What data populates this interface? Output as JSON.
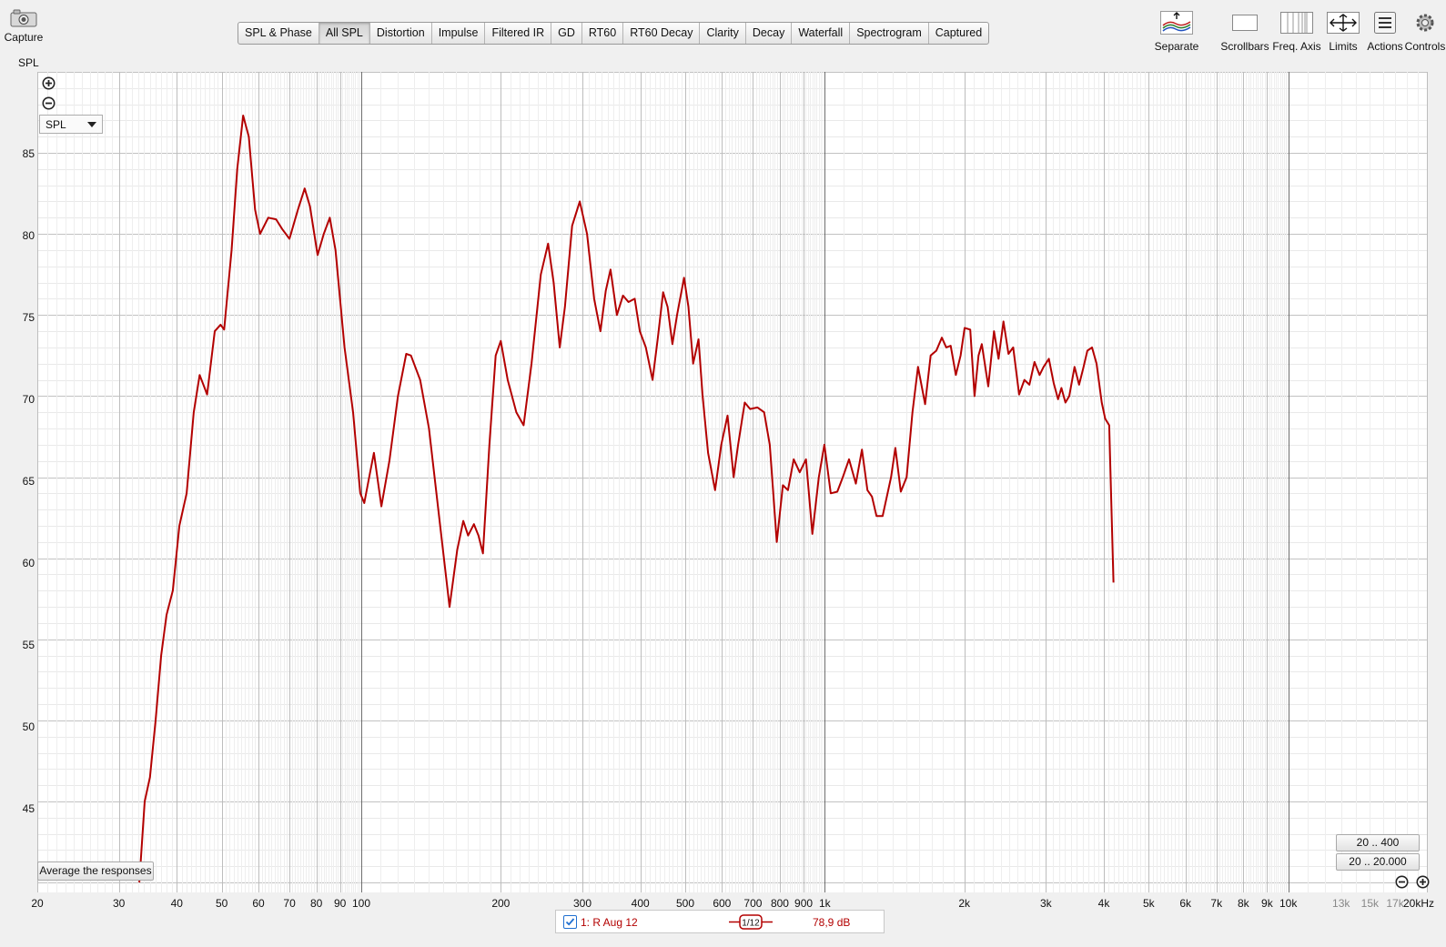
{
  "toolbar": {
    "capture_label": "Capture",
    "spl_label": "SPL",
    "tabs": [
      {
        "label": "SPL & Phase",
        "active": false
      },
      {
        "label": "All SPL",
        "active": true
      },
      {
        "label": "Distortion",
        "active": false
      },
      {
        "label": "Impulse",
        "active": false
      },
      {
        "label": "Filtered IR",
        "active": false
      },
      {
        "label": "GD",
        "active": false
      },
      {
        "label": "RT60",
        "active": false
      },
      {
        "label": "RT60 Decay",
        "active": false
      },
      {
        "label": "Clarity",
        "active": false
      },
      {
        "label": "Decay",
        "active": false
      },
      {
        "label": "Waterfall",
        "active": false
      },
      {
        "label": "Spectrogram",
        "active": false
      },
      {
        "label": "Captured",
        "active": false
      }
    ],
    "tools": {
      "separate": "Separate",
      "scrollbars": "Scrollbars",
      "freq_axis": "Freq. Axis",
      "limits": "Limits",
      "actions": "Actions",
      "controls": "Controls"
    }
  },
  "graph": {
    "selector_value": "SPL",
    "average_button": "Average the responses",
    "range_400": "20 .. 400",
    "range_20000": "20 .. 20.000",
    "line_color": "#b30000"
  },
  "legend": {
    "trace_name": "1: R Aug 12",
    "checked": true,
    "smoothing": "1/12",
    "cursor_value": "78,9 dB"
  },
  "chart_data": {
    "type": "line",
    "x_scale": "log",
    "xlim": [
      20,
      20000
    ],
    "ylim": [
      40,
      90
    ],
    "ylabel": "SPL",
    "grid": true,
    "y_ticks": [
      45,
      50,
      55,
      60,
      65,
      70,
      75,
      80,
      85
    ],
    "x_tick_labels": [
      {
        "f": 20,
        "label": "20"
      },
      {
        "f": 30,
        "label": "30"
      },
      {
        "f": 40,
        "label": "40"
      },
      {
        "f": 50,
        "label": "50"
      },
      {
        "f": 60,
        "label": "60"
      },
      {
        "f": 70,
        "label": "70"
      },
      {
        "f": 80,
        "label": "80"
      },
      {
        "f": 90,
        "label": "90"
      },
      {
        "f": 100,
        "label": "100"
      },
      {
        "f": 200,
        "label": "200"
      },
      {
        "f": 300,
        "label": "300"
      },
      {
        "f": 400,
        "label": "400"
      },
      {
        "f": 500,
        "label": "500"
      },
      {
        "f": 600,
        "label": "600"
      },
      {
        "f": 700,
        "label": "700"
      },
      {
        "f": 800,
        "label": "800"
      },
      {
        "f": 900,
        "label": "900"
      },
      {
        "f": 1000,
        "label": "1k"
      },
      {
        "f": 2000,
        "label": "2k"
      },
      {
        "f": 3000,
        "label": "3k"
      },
      {
        "f": 4000,
        "label": "4k"
      },
      {
        "f": 5000,
        "label": "5k"
      },
      {
        "f": 6000,
        "label": "6k"
      },
      {
        "f": 7000,
        "label": "7k"
      },
      {
        "f": 8000,
        "label": "8k"
      },
      {
        "f": 9000,
        "label": "9k"
      },
      {
        "f": 10000,
        "label": "10k"
      },
      {
        "f": 13000,
        "label": "13k",
        "minor": true
      },
      {
        "f": 15000,
        "label": "15k",
        "minor": true
      },
      {
        "f": 17000,
        "label": "17k",
        "minor": true
      },
      {
        "f": 20000,
        "label": "20kHz"
      }
    ],
    "series": [
      {
        "name": "1: R Aug 12",
        "color": "#b30000",
        "points": [
          [
            33.2,
            40
          ],
          [
            34.1,
            45
          ],
          [
            35.0,
            46.5
          ],
          [
            36.0,
            50
          ],
          [
            37.0,
            54
          ],
          [
            38.0,
            56.5
          ],
          [
            39.2,
            58
          ],
          [
            40.5,
            62
          ],
          [
            42.0,
            64
          ],
          [
            43.5,
            69
          ],
          [
            44.8,
            71.3
          ],
          [
            46.5,
            70.1
          ],
          [
            48.3,
            74
          ],
          [
            49.7,
            74.4
          ],
          [
            50.6,
            74.1
          ],
          [
            52.5,
            79
          ],
          [
            54.0,
            84
          ],
          [
            55.6,
            87.3
          ],
          [
            57.2,
            86
          ],
          [
            59.0,
            81.5
          ],
          [
            60.5,
            80
          ],
          [
            63.0,
            81
          ],
          [
            65.5,
            80.9
          ],
          [
            67.5,
            80.3
          ],
          [
            70.0,
            79.7
          ],
          [
            73.0,
            81.5
          ],
          [
            75.5,
            82.8
          ],
          [
            77.5,
            81.7
          ],
          [
            80.5,
            78.7
          ],
          [
            83.0,
            80
          ],
          [
            85.5,
            81
          ],
          [
            88.0,
            79
          ],
          [
            92.0,
            73
          ],
          [
            96.0,
            69
          ],
          [
            99.5,
            64
          ],
          [
            101.5,
            63.4
          ],
          [
            104.0,
            65
          ],
          [
            106.5,
            66.5
          ],
          [
            110.5,
            63.2
          ],
          [
            115.0,
            66
          ],
          [
            120.0,
            70
          ],
          [
            125.0,
            72.6
          ],
          [
            128.0,
            72.5
          ],
          [
            134.0,
            71
          ],
          [
            140.0,
            68
          ],
          [
            148.0,
            62
          ],
          [
            155.0,
            57
          ],
          [
            161.0,
            60.5
          ],
          [
            166.0,
            62.3
          ],
          [
            170.0,
            61.4
          ],
          [
            175.0,
            62.1
          ],
          [
            179.0,
            61.4
          ],
          [
            183.0,
            60.3
          ],
          [
            189.0,
            67
          ],
          [
            195.0,
            72.5
          ],
          [
            200.0,
            73.4
          ],
          [
            207.0,
            71
          ],
          [
            216.0,
            69
          ],
          [
            224.0,
            68.2
          ],
          [
            233.0,
            72
          ],
          [
            244.0,
            77.5
          ],
          [
            253.0,
            79.4
          ],
          [
            260.0,
            77
          ],
          [
            268.0,
            73
          ],
          [
            275.0,
            75.5
          ],
          [
            285.0,
            80.5
          ],
          [
            296.0,
            82
          ],
          [
            307.0,
            80
          ],
          [
            318.0,
            76
          ],
          [
            328.0,
            74
          ],
          [
            337.0,
            76.5
          ],
          [
            345.0,
            77.8
          ],
          [
            356.0,
            75
          ],
          [
            367.0,
            76.2
          ],
          [
            377.0,
            75.8
          ],
          [
            389.0,
            76
          ],
          [
            399.0,
            74
          ],
          [
            411.0,
            73
          ],
          [
            425.0,
            71
          ],
          [
            436.0,
            73.5
          ],
          [
            448.0,
            76.4
          ],
          [
            458.0,
            75.5
          ],
          [
            469.0,
            73.2
          ],
          [
            480.0,
            75
          ],
          [
            497.0,
            77.3
          ],
          [
            508.0,
            75.5
          ],
          [
            520.0,
            72
          ],
          [
            534.0,
            73.5
          ],
          [
            545.0,
            70
          ],
          [
            560.0,
            66.5
          ],
          [
            580.0,
            64.2
          ],
          [
            598.0,
            67
          ],
          [
            617.0,
            68.8
          ],
          [
            636.0,
            65
          ],
          [
            650.0,
            67
          ],
          [
            672.0,
            69.6
          ],
          [
            690.0,
            69.2
          ],
          [
            716.0,
            69.3
          ],
          [
            740.0,
            69
          ],
          [
            761.0,
            67
          ],
          [
            788.0,
            61
          ],
          [
            812.0,
            64.5
          ],
          [
            833.0,
            64.2
          ],
          [
            857.0,
            66.1
          ],
          [
            883.0,
            65.3
          ],
          [
            911.0,
            66.1
          ],
          [
            940.0,
            61.5
          ],
          [
            971.0,
            65
          ],
          [
            998.0,
            67
          ],
          [
            1030.0,
            64
          ],
          [
            1064.0,
            64.1
          ],
          [
            1094.0,
            65
          ],
          [
            1128.0,
            66.1
          ],
          [
            1167.0,
            64.6
          ],
          [
            1203.0,
            66.7
          ],
          [
            1236.0,
            64.2
          ],
          [
            1264.0,
            63.8
          ],
          [
            1293.0,
            62.6
          ],
          [
            1333.0,
            62.6
          ],
          [
            1390.0,
            65
          ],
          [
            1420.0,
            66.8
          ],
          [
            1459.0,
            64.1
          ],
          [
            1502.0,
            65
          ],
          [
            1546.0,
            69
          ],
          [
            1589.0,
            71.8
          ],
          [
            1646.0,
            69.5
          ],
          [
            1692.0,
            72.5
          ],
          [
            1740.0,
            72.8
          ],
          [
            1789.0,
            73.6
          ],
          [
            1828.0,
            73
          ],
          [
            1869.0,
            73.1
          ],
          [
            1918.0,
            71.3
          ],
          [
            1964.0,
            72.5
          ],
          [
            2003.0,
            74.2
          ],
          [
            2060.0,
            74.1
          ],
          [
            2104.0,
            70
          ],
          [
            2146.0,
            72.5
          ],
          [
            2182.0,
            73.2
          ],
          [
            2253.0,
            70.6
          ],
          [
            2318.0,
            74
          ],
          [
            2371.0,
            72.3
          ],
          [
            2430.0,
            74.6
          ],
          [
            2491.0,
            72.6
          ],
          [
            2550.0,
            73
          ],
          [
            2626.0,
            70.1
          ],
          [
            2696.0,
            71
          ],
          [
            2764.0,
            70.7
          ],
          [
            2835.0,
            72.1
          ],
          [
            2907.0,
            71.3
          ],
          [
            2966.0,
            71.8
          ],
          [
            3045.0,
            72.3
          ],
          [
            3118.0,
            70.8
          ],
          [
            3186.0,
            69.8
          ],
          [
            3240.0,
            70.5
          ],
          [
            3305.0,
            69.6
          ],
          [
            3369.0,
            70
          ],
          [
            3459.0,
            71.8
          ],
          [
            3537.0,
            70.7
          ],
          [
            3610.0,
            71.7
          ],
          [
            3686.0,
            72.8
          ],
          [
            3772.0,
            73
          ],
          [
            3858.0,
            72
          ],
          [
            3959.0,
            69.6
          ],
          [
            4028.0,
            68.6
          ],
          [
            4109.0,
            68.2
          ],
          [
            4196.0,
            58.5
          ]
        ]
      }
    ]
  }
}
